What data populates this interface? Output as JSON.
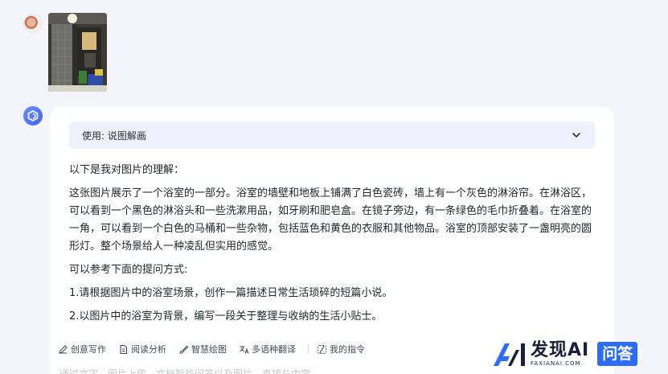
{
  "usage": {
    "label": "使用: 说图解画"
  },
  "content": {
    "intro": "以下是我对图片的理解：",
    "description": "这张图片展示了一个浴室的一部分。浴室的墙壁和地板上铺满了白色瓷砖，墙上有一个灰色的淋浴帘。在淋浴区，可以看到一个黑色的淋浴头和一些洗漱用品，如牙刷和肥皂盒。在镜子旁边，有一条绿色的毛巾折叠着。在浴室的一角，可以看到一个白色的马桶和一些杂物，包括蓝色和黄色的衣服和其他物品。浴室的顶部安装了一盏明亮的圆形灯。整个场景给人一种凌乱但实用的感觉。",
    "prompt_heading": "可以参考下面的提问方式:",
    "suggestions": [
      "1.请根据图片中的浴室场景，创作一篇描述日常生活琐碎的短篇小说。",
      "2.以图片中的浴室为背景，编写一段关于整理与收纳的生活小贴士。"
    ]
  },
  "toolbar": {
    "creative_writing": "创意写作",
    "reading_analysis": "阅读分析",
    "smart_drawing": "智慧绘图",
    "multi_translate": "多语种翻译",
    "my_commands": "我的指令"
  },
  "input": {
    "placeholder_partial": "通过文字，图片上传，文档智能问答以及图片，直接与内容"
  },
  "watermark": {
    "title": "发现AI",
    "subtitle": "FAXIANAI.COM",
    "badge": "问答"
  },
  "colors": {
    "accent": "#2d6cf5",
    "usage_bg": "#eef0fb",
    "page_bg": "#f3f5fa"
  },
  "icons": {
    "expand": "chevron-down-icon",
    "creative_writing": "pen-icon",
    "reading_analysis": "document-icon",
    "smart_drawing": "brush-icon",
    "multi_translate": "translate-icon",
    "my_commands": "slash-command-icon"
  }
}
